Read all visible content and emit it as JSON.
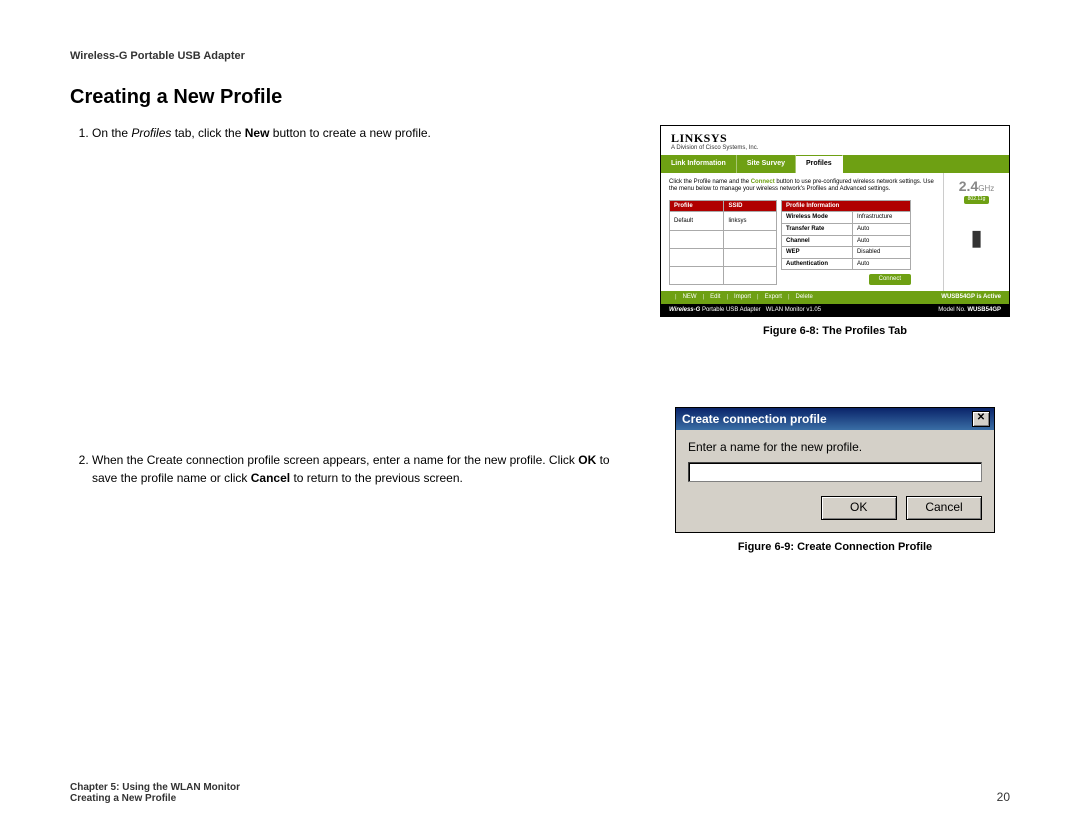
{
  "header": {
    "product": "Wireless-G Portable USB Adapter"
  },
  "title": "Creating a New Profile",
  "steps": {
    "s1": {
      "pre": "On the ",
      "italic": "Profiles",
      "mid": " tab, click the ",
      "bold": "New",
      "post": " button to create a new profile."
    },
    "s2": {
      "pre": "When the Create connection profile screen appears, enter a name for the new profile. Click ",
      "bold1": "OK",
      "mid": " to save the profile name or click ",
      "bold2": "Cancel",
      "post": " to return to the previous screen."
    }
  },
  "figure8": {
    "caption": "Figure 6-8: The Profiles Tab",
    "logo": "LINKSYS",
    "logo_tag": "A Division of Cisco Systems, Inc.",
    "tabs": {
      "link": "Link Information",
      "survey": "Site Survey",
      "profiles": "Profiles"
    },
    "instr_pre": "Click the Profile name and the ",
    "instr_connect": "Connect",
    "instr_post": " button to use pre-configured wireless network settings. Use the menu below to manage your wireless network's Profiles and Advanced settings.",
    "list_headers": {
      "profile": "Profile",
      "ssid": "SSID"
    },
    "list_row": {
      "profile": "Default",
      "ssid": "linksys"
    },
    "info_header": "Profile Information",
    "info_rows": [
      {
        "k": "Wireless Mode",
        "v": "Infrastructure"
      },
      {
        "k": "Transfer Rate",
        "v": "Auto"
      },
      {
        "k": "Channel",
        "v": "Auto"
      },
      {
        "k": "WEP",
        "v": "Disabled"
      },
      {
        "k": "Authentication",
        "v": "Auto"
      }
    ],
    "connect_btn": "Connect",
    "ghz_num": "2.4",
    "ghz_unit": "GHz",
    "ghz_badge": "802.11g",
    "greenbar": {
      "new": "NEW",
      "edit": "Edit",
      "import": "Import",
      "export": "Export",
      "delete": "Delete",
      "status": "WUSB54GP is Active"
    },
    "blackbar": {
      "brand": "Wireless-G",
      "prod": " Portable USB Adapter",
      "mon": "WLAN Monitor  v1.05",
      "model_lbl": "Model No.",
      "model": "WUSB54GP"
    }
  },
  "figure9": {
    "caption": "Figure 6-9: Create Connection Profile",
    "title": "Create connection profile",
    "prompt": "Enter a name for the new profile.",
    "input_value": "",
    "ok": "OK",
    "cancel": "Cancel",
    "close": "✕"
  },
  "footer": {
    "chapter": "Chapter 5: Using the WLAN Monitor",
    "section": "Creating a New Profile",
    "page": "20"
  }
}
